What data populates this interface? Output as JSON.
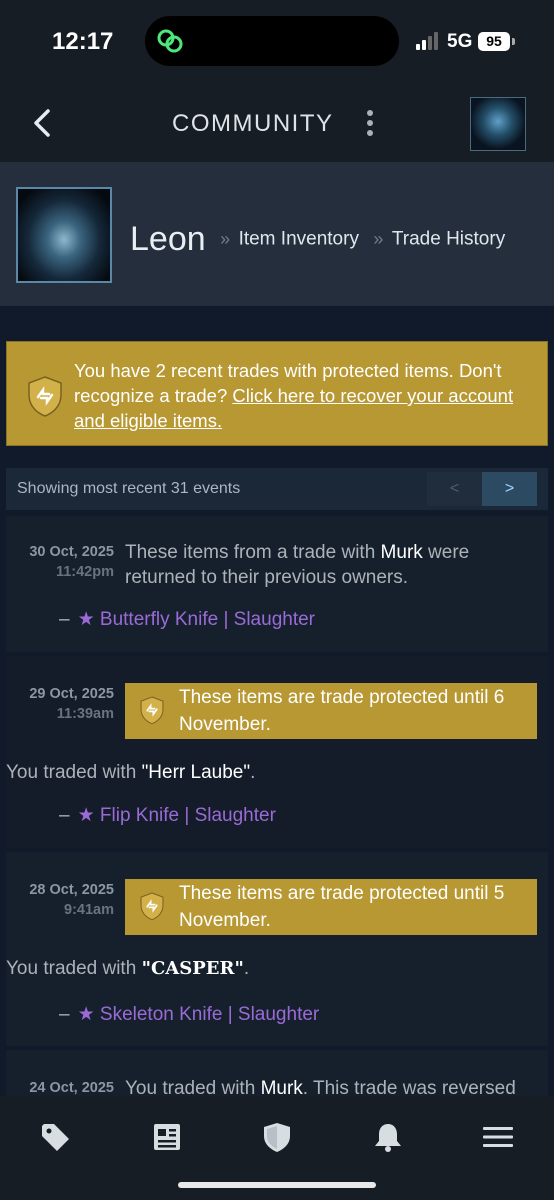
{
  "status": {
    "time": "12:17",
    "network": "5G",
    "battery": "95"
  },
  "header": {
    "title": "COMMUNITY"
  },
  "profile": {
    "name": "Leon",
    "crumb_sep": "»",
    "crumb1": "Item Inventory",
    "crumb2": "Trade History"
  },
  "alert": {
    "text": "You have 2 recent trades with protected items. Don't recognize a trade?",
    "link": "Click here to recover your account and eligible items."
  },
  "events": {
    "label": "Showing most recent 31 events",
    "prev": "<",
    "next": ">"
  },
  "trades": [
    {
      "date": "30 Oct, 2025",
      "time": "11:42pm",
      "desc_pre": "These items from a trade with ",
      "partner": "Murk",
      "desc_post": " were returned to their previous owners.",
      "dash": "–",
      "item": "★ Butterfly Knife | Slaughter"
    },
    {
      "date": "29 Oct, 2025",
      "time": "11:39am",
      "protected": "These items are trade protected until 6 November.",
      "traded_pre": "You traded with ",
      "partner": "\"Herr Laube\"",
      "traded_post": ".",
      "dash": "–",
      "item": "★ Flip Knife | Slaughter"
    },
    {
      "date": "28 Oct, 2025",
      "time": "9:41am",
      "protected": "These items are trade protected until 5 November.",
      "traded_pre": "You traded with ",
      "partner": "\"CASPER\"",
      "traded_post": ".",
      "dash": "–",
      "item": "★ Skeleton Knife | Slaughter"
    },
    {
      "date": "24 Oct, 2025",
      "desc_pre": "You traded with ",
      "partner": "Murk",
      "desc_post": ". This trade was reversed"
    }
  ],
  "tabs": [
    "tag-icon",
    "news-icon",
    "shield-icon",
    "bell-icon",
    "menu-icon"
  ],
  "colors": {
    "gold": "#b89833",
    "item_purple": "#9a6bd6",
    "bg": "#101a2b"
  }
}
